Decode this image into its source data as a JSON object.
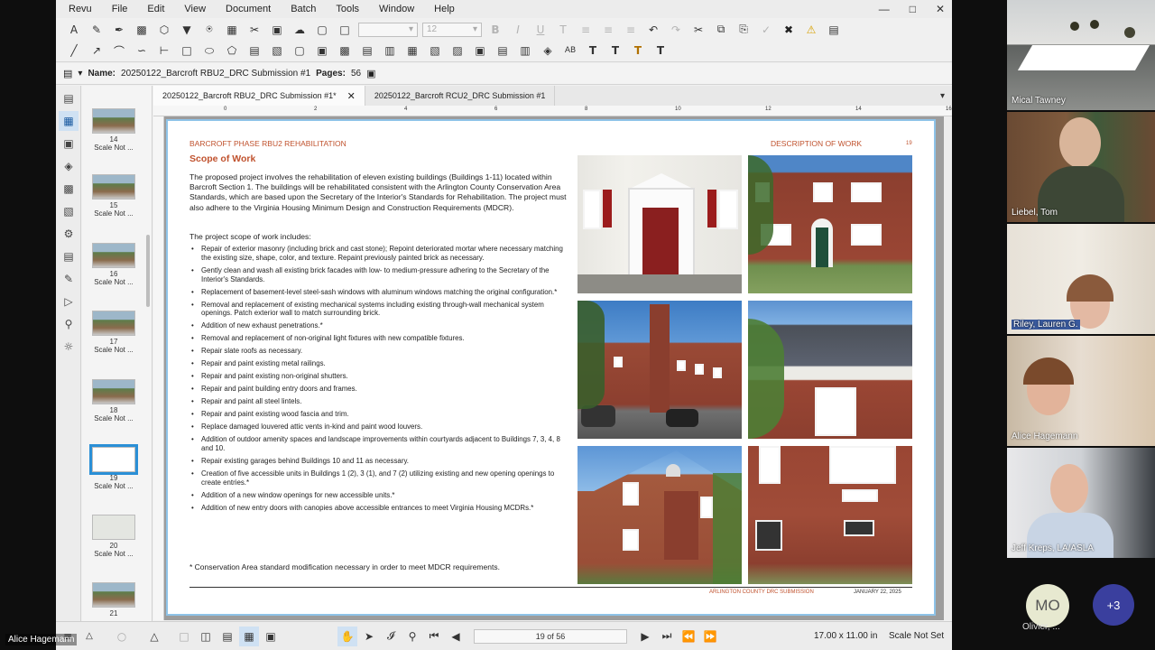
{
  "menubar": {
    "items": [
      "Revu",
      "File",
      "Edit",
      "View",
      "Document",
      "Batch",
      "Tools",
      "Window",
      "Help"
    ]
  },
  "toolbar": {
    "font_size": "12"
  },
  "docbar": {
    "name_label": "Name:",
    "name_value": "20250122_Barcroft RBU2_DRC Submission #1",
    "pages_label": "Pages:",
    "pages_value": "56"
  },
  "tabs": [
    {
      "label": "20250122_Barcroft RBU2_DRC Submission #1*"
    },
    {
      "label": "20250122_Barcroft RCU2_DRC Submission #1"
    }
  ],
  "ruler": {
    "ticks": [
      "0",
      "2",
      "4",
      "6",
      "8",
      "10",
      "12",
      "14",
      "16"
    ]
  },
  "thumbnails": [
    {
      "num": "14",
      "label": "Scale Not ..."
    },
    {
      "num": "15",
      "label": "Scale Not ..."
    },
    {
      "num": "16",
      "label": "Scale Not ..."
    },
    {
      "num": "17",
      "label": "Scale Not ..."
    },
    {
      "num": "18",
      "label": "Scale Not ..."
    },
    {
      "num": "19",
      "label": "Scale Not ..."
    },
    {
      "num": "20",
      "label": "Scale Not ..."
    },
    {
      "num": "21",
      "label": ""
    }
  ],
  "page": {
    "title_left": "BARCROFT PHASE RBU2 REHABILITATION",
    "title_right": "DESCRIPTION OF WORK",
    "page_num": "19",
    "heading": "Scope of Work",
    "intro": "The proposed project involves the rehabilitation of eleven existing buildings (Buildings 1-11) located within Barcroft Section 1. The buildings will be rehabilitated consistent with the Arlington County Conservation Area Standards, which are based upon the Secretary of the Interior's Standards for Rehabilitation. The project must also adhere to the Virginia Housing Minimum Design and Construction Requirements (MDCR).",
    "scope_heading": "The project scope of work includes:",
    "bullets": [
      "Repair of exterior masonry (including brick and cast stone); Repoint deteriorated mortar where necessary matching the existing size, shape, color, and texture. Repaint previously painted brick as necessary.",
      "Gently clean and wash all existing brick facades with low- to medium-pressure adhering to the Secretary of the Interior's Standards.",
      "Replacement of basement-level steel-sash windows with aluminum windows matching the original configuration.*",
      "Removal and replacement of existing mechanical systems including existing through-wall mechanical system openings. Patch exterior wall to match surrounding brick.",
      "Addition of new exhaust penetrations.*",
      "Removal and replacement of non-original light fixtures with new compatible fixtures.",
      "Repair slate roofs as necessary.",
      "Repair and paint existing metal railings.",
      "Repair and paint existing non-original shutters.",
      "Repair and paint building entry doors and frames.",
      "Repair and paint all steel lintels.",
      "Repair and paint existing wood fascia and trim.",
      "Replace damaged louvered attic vents in-kind and paint wood louvers.",
      "Addition of outdoor amenity spaces and landscape improvements within courtyards adjacent to Buildings 7, 3, 4, 8 and 10.",
      "Repair existing garages behind Buildings 10 and 11 as necessary.",
      "Creation of five accessible units in Buildings 1 (2), 3 (1), and 7 (2) utilizing existing and new opening openings to create entries.*",
      "Addition of a new window openings for new accessible units.*",
      "Addition of new entry doors with canopies above accessible entrances to meet Virginia Housing MCDRs.*"
    ],
    "footnote": "* Conservation Area standard modification necessary in order to meet MDCR requirements.",
    "footer_left": "ARLINGTON COUNTY DRC SUBMISSION",
    "footer_right": "JANUARY 22, 2025",
    "accent_color": "#c0522e"
  },
  "statusbar": {
    "page_indicator": "19 of 56",
    "dimensions": "17.00 x 11.00 in",
    "scale": "Scale Not Set"
  },
  "participants": [
    {
      "name": "Mical Tawney"
    },
    {
      "name": "Liebel, Tom"
    },
    {
      "name": "Riley, Lauren G."
    },
    {
      "name": "Alice Hagemann"
    },
    {
      "name": "Jeff Kreps, LA/ASLA"
    }
  ],
  "overflow": {
    "initials": "MO",
    "name": "Olivier, ...",
    "more": "+3"
  },
  "self_view": {
    "name": "Alice Hagemann"
  }
}
